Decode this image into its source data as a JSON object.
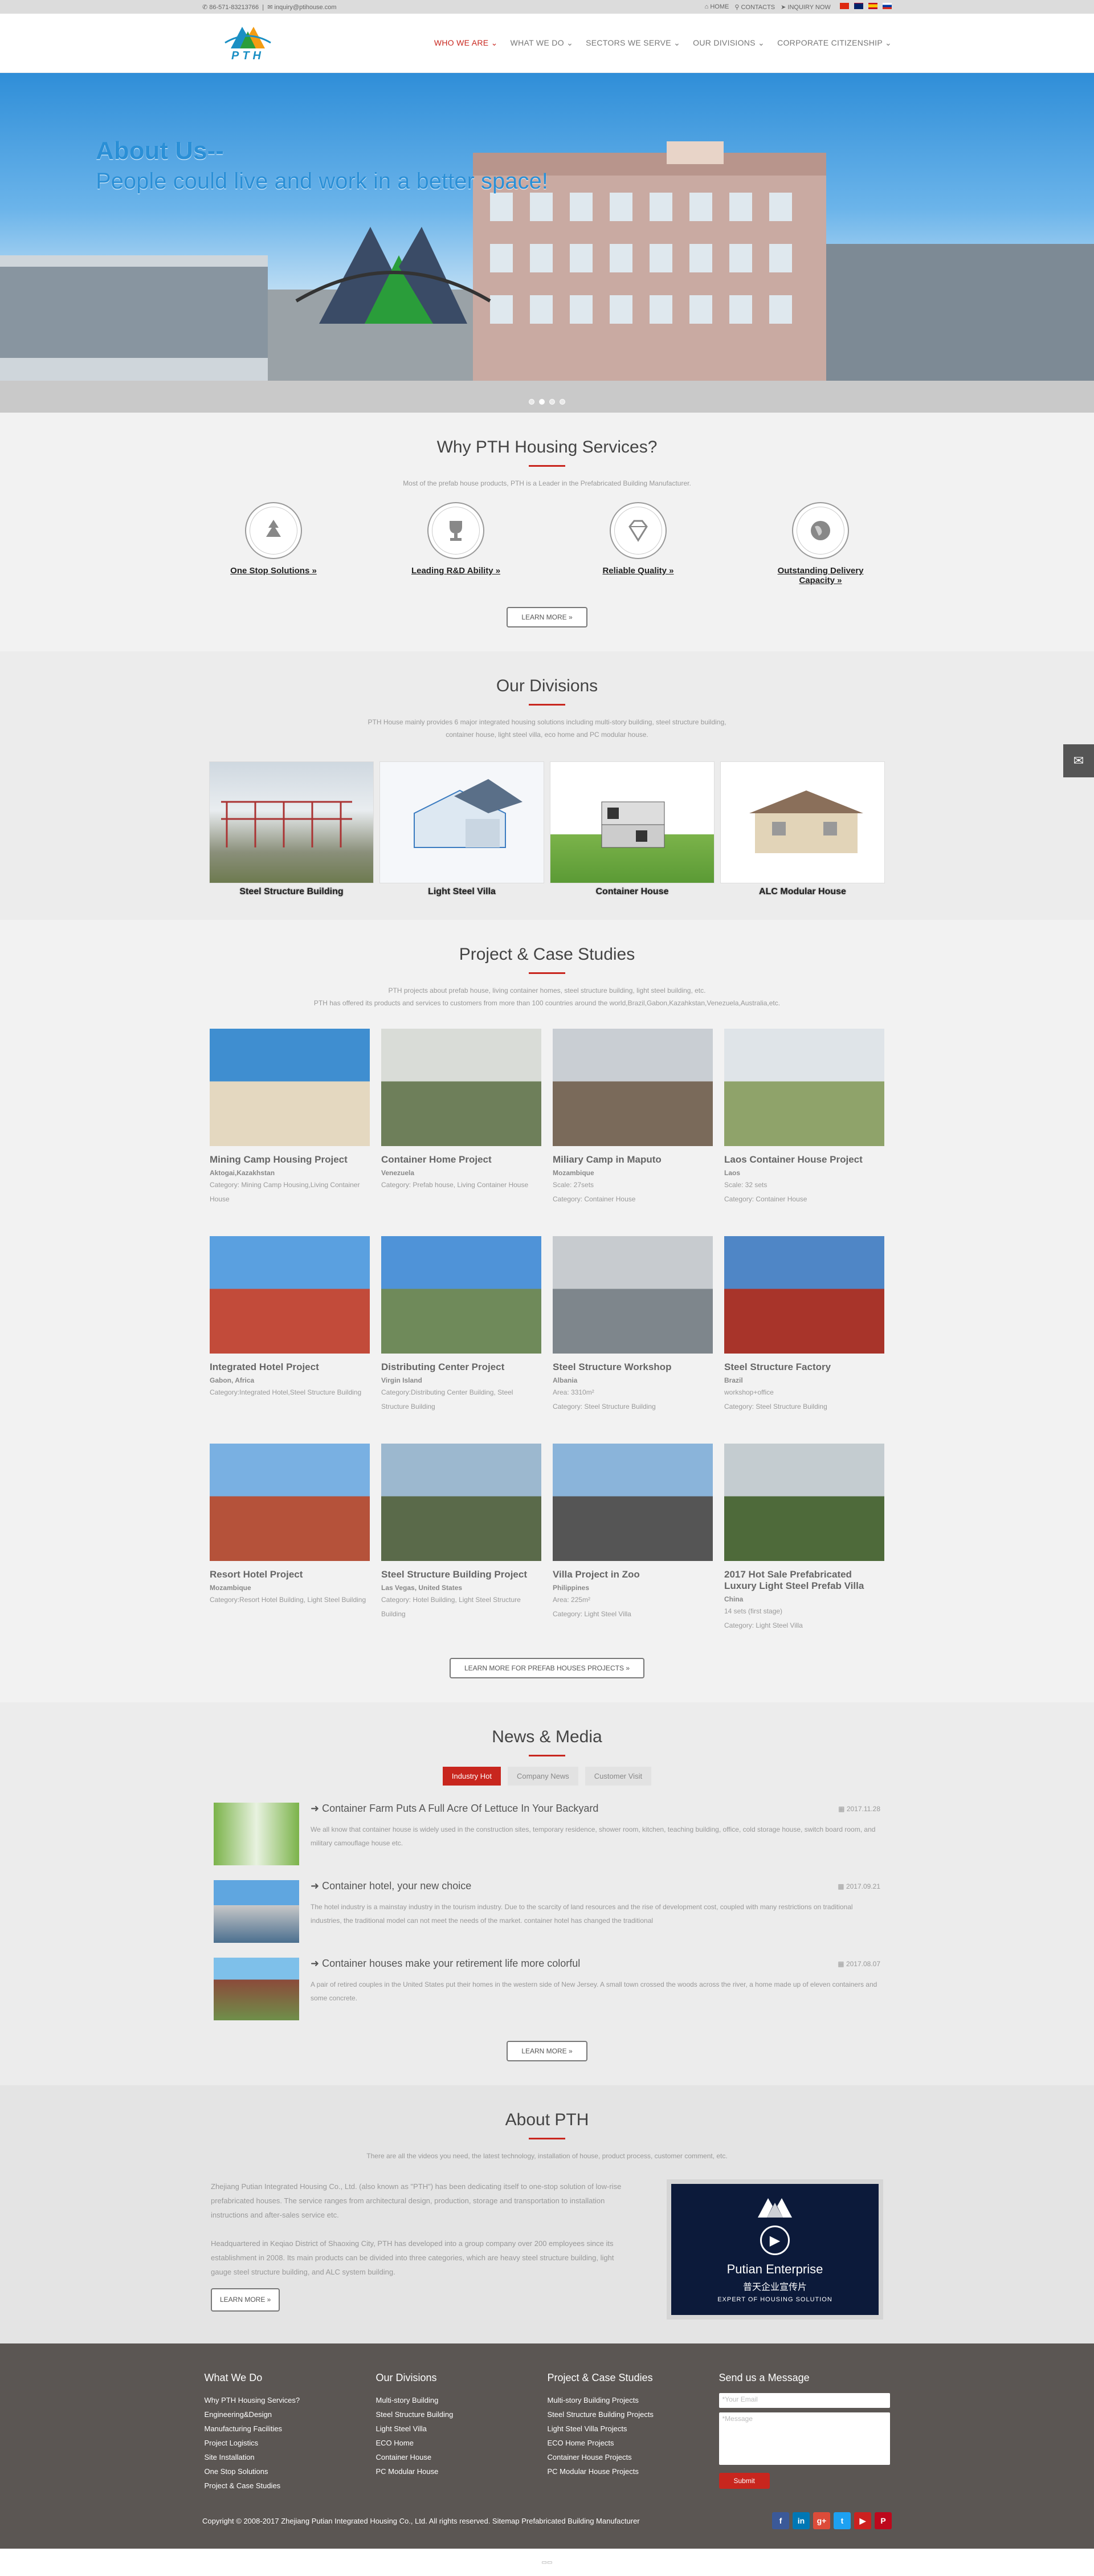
{
  "topbar": {
    "phone": "86-571-83213766",
    "email": "inquiry@ptihouse.com",
    "home": "HOME",
    "contacts": "CONTACTS",
    "inquiry": "INQUIRY NOW"
  },
  "logo": {
    "text": "PTH"
  },
  "nav": [
    "WHO WE ARE",
    "WHAT WE DO",
    "SECTORS WE SERVE",
    "OUR DIVISIONS",
    "CORPORATE CITIZENSHIP"
  ],
  "hero": {
    "title": "About Us--",
    "subtitle": "People could live and work in a better space!"
  },
  "why": {
    "title": "Why PTH Housing Services?",
    "desc": "Most of the prefab house products, PTH is a Leader in the Prefabricated Building Manufacturer.",
    "items": [
      {
        "label": "One Stop Solutions »",
        "icon": "recycle-icon"
      },
      {
        "label": "Leading R&D Ability »",
        "icon": "trophy-icon"
      },
      {
        "label": "Reliable Quality »",
        "icon": "diamond-icon"
      },
      {
        "label": "Outstanding Delivery Capacity »",
        "icon": "globe-icon"
      }
    ],
    "button": "LEARN MORE »"
  },
  "divisions": {
    "title": "Our Divisions",
    "desc1": "PTH House mainly provides 6 major integrated housing solutions including multi-story building, steel structure building,",
    "desc2": "container house, light steel villa, eco home and PC modular house.",
    "items": [
      "Steel Structure Building",
      "Light Steel Villa",
      "Container House",
      "ALC Modular House"
    ]
  },
  "projects": {
    "title": "Project & Case Studies",
    "desc1": "PTH projects about prefab house, living container homes, steel structure building, light steel building, etc.",
    "desc2": "PTH has offered its products and services to customers from more than 100 countries around the world,Brazil,Gabon,Kazahkstan,Venezuela,Australia,etc.",
    "items": [
      {
        "name": "Mining Camp Housing Project",
        "loc": "Aktogai,Kazakhstan",
        "info": "Category: Mining Camp Housing,Living Container House"
      },
      {
        "name": "Container Home Project",
        "loc": "Venezuela",
        "info": "Category: Prefab house, Living Container House"
      },
      {
        "name": "Miliary Camp in Maputo",
        "loc": "Mozambique",
        "info": "Scale: 27sets\nCategory: Container House"
      },
      {
        "name": "Laos Container House Project",
        "loc": "Laos",
        "info": "Scale: 32 sets\nCategory: Container House"
      },
      {
        "name": "Integrated Hotel Project",
        "loc": "Gabon, Africa",
        "info": "Category:Integrated Hotel,Steel Structure Building"
      },
      {
        "name": "Distributing Center Project",
        "loc": "Virgin Island",
        "info": "Category:Distributing Center Building, Steel Structure Building"
      },
      {
        "name": "Steel Structure Workshop",
        "loc": "Albania",
        "info": "Area: 3310m²\nCategory: Steel Structure Building"
      },
      {
        "name": "Steel Structure Factory",
        "loc": "Brazil",
        "info": "workshop+office\nCategory: Steel Structure Building"
      },
      {
        "name": "Resort Hotel Project",
        "loc": "Mozambique",
        "info": "Category:Resort Hotel Building, Light Steel Building"
      },
      {
        "name": "Steel Structure Building Project",
        "loc": "Las Vegas, United States",
        "info": "Category: Hotel Building, Light Steel Structure Building"
      },
      {
        "name": "Villa Project in Zoo",
        "loc": "Philippines",
        "info": "Area: 225m²\nCategory: Light Steel Villa"
      },
      {
        "name": "2017 Hot Sale Prefabricated Luxury Light Steel Prefab Villa",
        "loc": "China",
        "info": "14 sets (first stage)\nCategory: Light Steel Villa"
      }
    ],
    "button": "LEARN MORE FOR PREFAB HOUSES PROJECTS »"
  },
  "news": {
    "title": "News & Media",
    "tabs": [
      "Industry Hot",
      "Company News",
      "Customer Visit"
    ],
    "items": [
      {
        "title": "Container Farm Puts A Full Acre Of Lettuce In Your Backyard",
        "date": "2017.11.28",
        "text": "We all know that container house is widely used in the construction sites, temporary residence, shower room, kitchen, teaching building, office, cold storage house, switch board room, and military camouflage house etc."
      },
      {
        "title": "Container hotel, your new choice",
        "date": "2017.09.21",
        "text": "The hotel industry is a mainstay industry in the tourism industry. Due to the scarcity of land resources and the rise of development cost, coupled with many restrictions on traditional industries, the traditional model can not meet the needs of the market. container hotel has changed the traditional"
      },
      {
        "title": "Container houses make your retirement life more colorful",
        "date": "2017.08.07",
        "text": "A pair of retired couples in the United States put their homes in the western side of New Jersey. A small town crossed the woods across the river, a home made up of eleven containers and some concrete."
      }
    ],
    "button": "LEARN MORE »"
  },
  "about": {
    "title": "About PTH",
    "desc": "There are all the videos you need, the latest technology, installation of house, product process, customer comment, etc.",
    "p1": "Zhejiang Putian Integrated Housing Co., Ltd. (also known as \"PTH\") has been dedicating itself to one-stop solution of low-rise prefabricated houses. The service ranges from architectural design, production, storage and transportation to installation instructions and after-sales service etc.",
    "p2": "Headquartered in Keqiao District of Shaoxing City, PTH has developed into a group company over 200 employees since its establishment in 2008. Its main products can be divided into three categories, which are heavy steel structure building, light gauge steel structure building, and ALC system building.",
    "button": "LEARN MORE »",
    "video_title": "Putian Enterprise",
    "video_cn": "普天企业宣传片",
    "video_sub": "EXPERT OF HOUSING SOLUTION"
  },
  "footer": {
    "cols": [
      {
        "title": "What We Do",
        "links": [
          "Why PTH Housing Services?",
          "Engineering&Design",
          "Manufacturing Facilities",
          "Project Logistics",
          "Site Installation",
          "One Stop Solutions",
          "Project & Case Studies"
        ]
      },
      {
        "title": "Our Divisions",
        "links": [
          "Multi-story Building",
          "Steel Structure Building",
          "Light Steel Villa",
          "ECO Home",
          "Container House",
          "PC Modular House"
        ]
      },
      {
        "title": "Project & Case Studies",
        "links": [
          "Multi-story Building Projects",
          "Steel Structure Building Projects",
          "Light Steel Villa Projects",
          "ECO Home Projects",
          "Container House Projects",
          "PC Modular House Projects"
        ]
      }
    ],
    "msg_title": "Send us a Message",
    "email_ph": "*Your Email",
    "message_ph": "*Message",
    "submit": "Submit",
    "copyright": "Copyright  © 2008-2017 Zhejiang Putian Integrated Housing Co., Ltd. All rights reserved.   Sitemap Prefabricated Building Manufacturer",
    "socials": [
      {
        "icon": "f",
        "color": "#3b5998"
      },
      {
        "icon": "in",
        "color": "#0077b5"
      },
      {
        "icon": "g+",
        "color": "#dd4b39"
      },
      {
        "icon": "t",
        "color": "#1da1f2"
      },
      {
        "icon": "▶",
        "color": "#cd201f"
      },
      {
        "icon": "P",
        "color": "#bd081c"
      }
    ]
  },
  "colors": {
    "accent": "#c8261e",
    "footer": "#5b5653",
    "logo": "#1a8fc4"
  }
}
